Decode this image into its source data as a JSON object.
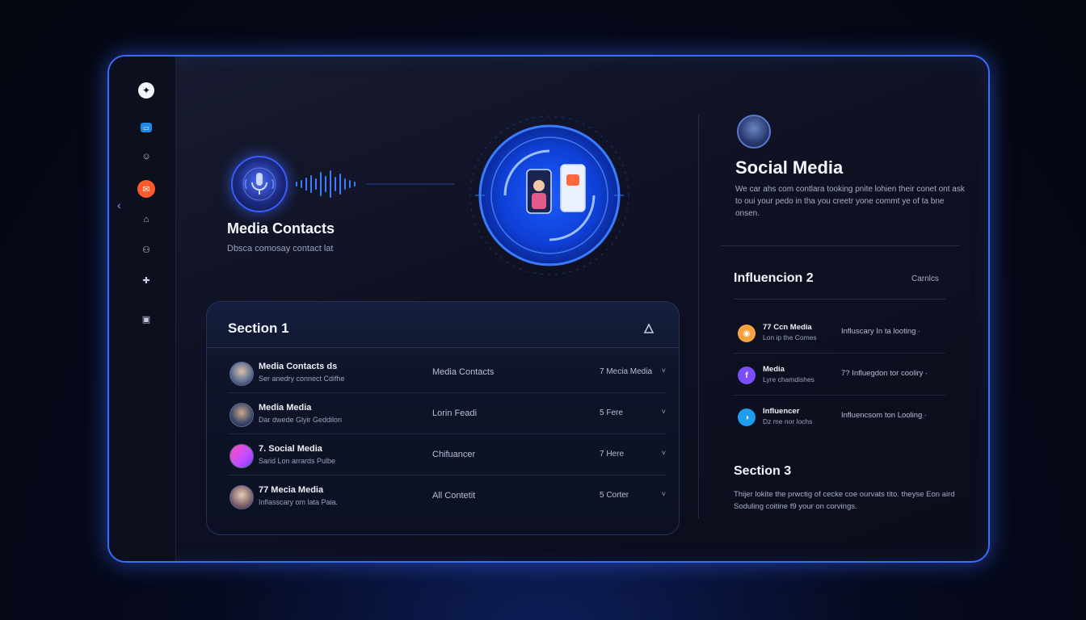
{
  "sidebar": {
    "items": [
      {
        "icon": "logo-icon",
        "glyph": "✦"
      },
      {
        "icon": "chat-icon",
        "glyph": "▭"
      },
      {
        "icon": "smile-icon",
        "glyph": "☺"
      },
      {
        "icon": "mail-icon",
        "glyph": "✉"
      },
      {
        "icon": "inbox-icon",
        "glyph": "⌂"
      },
      {
        "icon": "user-icon",
        "glyph": "⚇"
      },
      {
        "icon": "puzzle-icon",
        "glyph": "✚"
      },
      {
        "icon": "chart-icon",
        "glyph": "▣"
      }
    ],
    "collapse_glyph": "‹"
  },
  "hero": {
    "title": "Media Contacts",
    "subtitle": "Dbsca comosay contact lat"
  },
  "section1": {
    "title": "Section 1",
    "rows": [
      {
        "name": "Media Contacts ds",
        "desc": "Ser anedry connect Cdifhe",
        "mid": "Media Contacts",
        "right": "7 Mecia Media"
      },
      {
        "name": "Media Media",
        "desc": "Dar dwede Glyir Geddilon",
        "mid": "Lorin Feadi",
        "right": "5 Fere"
      },
      {
        "name": "7. Social Media",
        "desc": "Sarid Lon arrards Pulbe",
        "mid": "Chifuancer",
        "right": "7 Here"
      },
      {
        "name": "77 Mecia Media",
        "desc": "Inflasscary om lata Paia.",
        "mid": "All Contetit",
        "right": "5 Corter"
      }
    ],
    "chevron": "˅"
  },
  "right_panel": {
    "title": "Social Media",
    "body": "We car ahs com contlara tooking pnite lohien their conet ont ask to oui your pedo in tha you creetr yone commt ye of ta bne onsen."
  },
  "influencer": {
    "title": "Influencion 2",
    "link": "Carnlcs",
    "rows": [
      {
        "name": "77 Ccn Media",
        "desc": "Lon ip the Comes",
        "right": "Influscary In ta looting ·",
        "icon_color": "#f4a340",
        "glyph": "◉"
      },
      {
        "name": "Media",
        "desc": "Lyre chamdishes",
        "right": "7? Influegdon tor cooliry ·",
        "icon_color": "#7a4dff",
        "glyph": "f"
      },
      {
        "name": "Influencer",
        "desc": "Dz me nor lochs",
        "right": "Influencsom ton Looling ·",
        "icon_color": "#1e9cf0",
        "glyph": "◑"
      }
    ]
  },
  "section3": {
    "title": "Section 3",
    "body": "Thijer lokite the prwctig of cecke coe ourvats tito. theyse Eon aird Soduling coitine f9 your on corvings."
  },
  "colors": {
    "accent": "#3b6cff",
    "active_nav": "#ff5a2a",
    "background": "#0a0d1b"
  }
}
